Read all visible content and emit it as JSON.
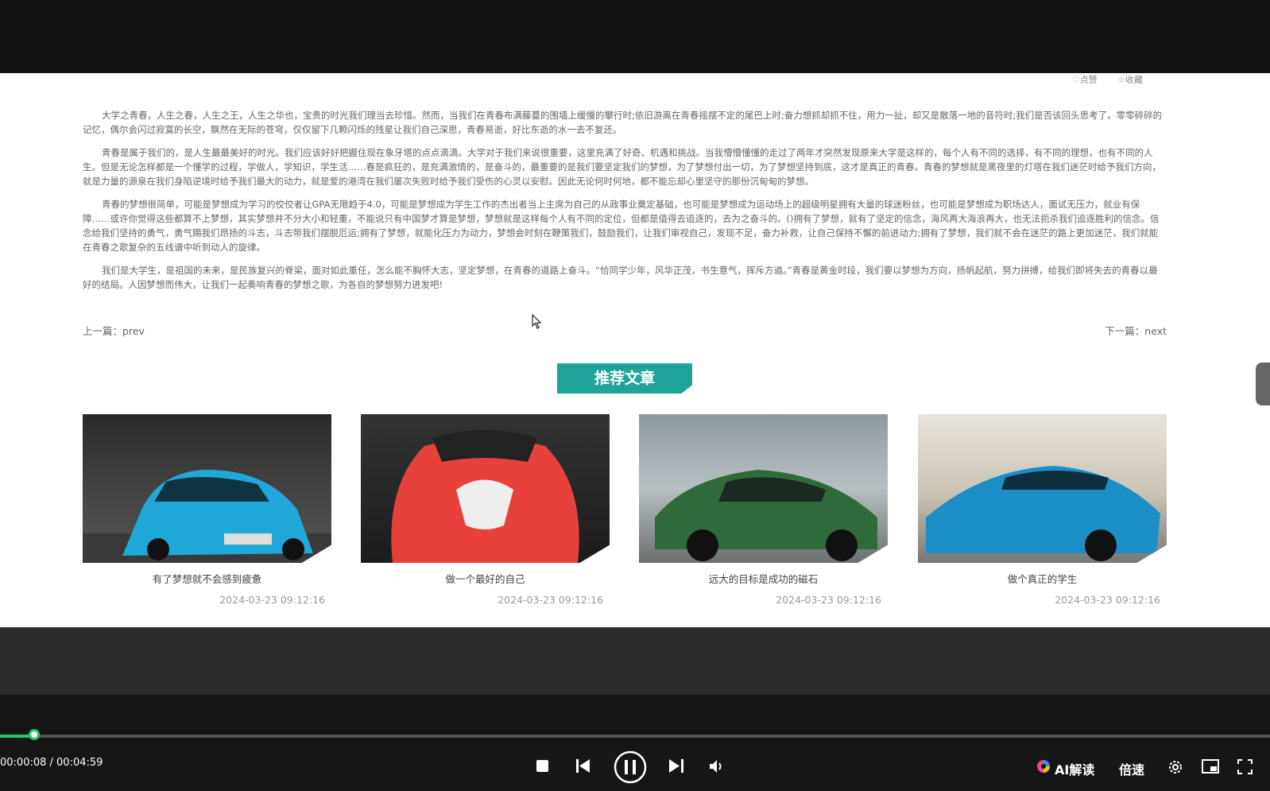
{
  "article": {
    "likes": {
      "like_label": "♡点赞",
      "fav_label": "☆收藏"
    },
    "paragraphs": [
      "大学之青春，人生之春，人生之王，人生之华也，宝贵的时光我们理当去珍惜。然而，当我们在青春布满藤蔓的围墙上缓慢的攀行时;依旧游离在青春摇摆不定的尾巴上时;奋力想抓却抓不住，用力一扯，却又是散落一地的音符时;我们是否该回头思考了。零零碎碎的记忆，偶尔会闪过寂寞的长空，飘然在无际的苍穹，仅仅留下几颗闪烁的残星让我们自己深思，青春易逝，好比东逝的水一去不复还。",
      "青春是属于我们的，是人生最最美好的时光。我们应该好好把握住现在象牙塔的点点滴滴。大学对于我们来说很重要，这里充满了好奇、机遇和挑战。当我懵懵懂懂的走过了两年才突然发现原来大学是这样的，每个人有不同的选择，有不同的理想，也有不同的人生。但是无论怎样都是一个懂学的过程，学做人，学知识，学生活……春是疯狂的，是充满激情的，是奋斗的，最重要的是我们要坚定我们的梦想，为了梦想付出一切，为了梦想坚持到底，这才是真正的青春。青春的梦想就是黑夜里的灯塔在我们迷茫时给予我们方向，就是力量的源泉在我们身陷逆境时给予我们最大的动力，就是爱的港湾在我们屡次失败时给予我们受伤的心灵以安慰。因此无论何时何地，都不能忘却心里坚守的那份沉甸甸的梦想。",
      "青春的梦想很简单，可能是梦想成为学习的佼佼者让GPA无限趋于4.0，可能是梦想成为学生工作的杰出者当上主席为自己的从政事业奠定基础，也可能是梦想成为运动场上的超级明星拥有大量的球迷粉丝，也可能是梦想成为职场达人，面试无压力，就业有保障……或许你觉得这些都算不上梦想，其实梦想并不分大小和轻重，不能说只有中国梦才算是梦想，梦想就是这样每个人有不同的定位，但都是值得去追逐的，去为之奋斗的。()拥有了梦想，就有了坚定的信念，海风再大海浪再大，也无法扼杀我们追逐胜利的信念。信念给我们坚持的勇气，勇气赐我们昂扬的斗志，斗志带我们摆脱厄运;拥有了梦想，就能化压力为动力，梦想会时刻在鞭策我们，鼓励我们，让我们审视自己，发现不足，奋力补救，让自己保持不懈的前进动力;拥有了梦想，我们就不会在迷茫的路上更加迷茫，我们就能在青春之歌复杂的五线谱中听到动人的旋律。",
      "我们是大学生，是祖国的未来，是民族复兴的脊梁，面对如此重任，怎么能不胸怀大志，坚定梦想，在青春的道路上奋斗。“恰同学少年，风华正茂，书生意气，挥斥方遒。”青春是黄金时段，我们要以梦想为方向，扬帆起航，努力拼搏，给我们即将失去的青春以最好的结局。人因梦想而伟大，让我们一起奏响青春的梦想之歌，为各自的梦想努力进发吧!"
    ],
    "prev_label": "上一篇：prev",
    "next_label": "下一篇：next"
  },
  "recommend": {
    "title": "推荐文章",
    "items": [
      {
        "caption": "有了梦想就不会感到疲惫",
        "date": "2024-03-23 09:12:16",
        "car_color": "#1fa8d8"
      },
      {
        "caption": "做一个最好的自己",
        "date": "2024-03-23 09:12:16",
        "car_color": "#e8403a"
      },
      {
        "caption": "远大的目标是成功的磁石",
        "date": "2024-03-23 09:12:16",
        "car_color": "#2f6b3a"
      },
      {
        "caption": "做个真正的学生",
        "date": "2024-03-23 09:12:16",
        "car_color": "#1c8fc7"
      }
    ]
  },
  "player": {
    "time": "00:00:08 / 00:04:59",
    "progress": 0.027,
    "ai_label": "AI解读",
    "speed_label": "倍速",
    "accent": "#2bc36b"
  }
}
